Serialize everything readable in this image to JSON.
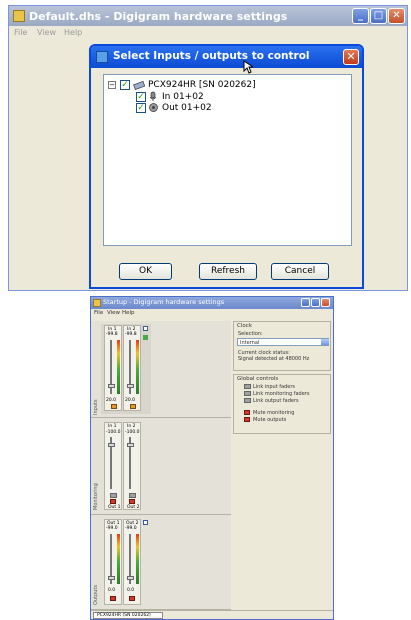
{
  "top_window": {
    "title": "Default.dhs - Digigram hardware settings",
    "menu": [
      "File",
      "View",
      "Help"
    ],
    "buttons": {
      "minimize": "_",
      "maximize": "□",
      "close": "✕"
    }
  },
  "dialog": {
    "title": "Select Inputs / outputs to control",
    "tree": {
      "root": "PCX924HR [SN 020262]",
      "children": [
        "In 01+02",
        "Out 01+02"
      ]
    },
    "buttons": {
      "ok": "OK",
      "refresh": "Refresh",
      "cancel": "Cancel"
    },
    "close_glyph": "✕",
    "expander_glyph": "−",
    "check_glyph": "✓"
  },
  "bottom_window": {
    "title": "Startup - Digigram hardware settings",
    "menu": [
      "File",
      "View",
      "Help"
    ],
    "sections": {
      "inputs": {
        "label": "Inputs",
        "strips": [
          {
            "name": "In 1",
            "gain": "-99.8",
            "value": "20.0"
          },
          {
            "name": "In 2",
            "gain": "-99.8",
            "value": "20.0"
          }
        ]
      },
      "monitoring": {
        "label": "Monitoring",
        "strips": [
          {
            "name": "In 1",
            "value": "-100.0",
            "bottom": "Out 1"
          },
          {
            "name": "In 2",
            "value": "-100.0",
            "bottom": "Out 2"
          }
        ]
      },
      "outputs": {
        "label": "Outputs",
        "strips": [
          {
            "name": "Out 1",
            "value": "-99.0",
            "level": "0.0"
          },
          {
            "name": "Out 2",
            "value": "-99.0",
            "level": "0.0"
          }
        ]
      }
    },
    "clock": {
      "title": "Clock",
      "selection_label": "Selection:",
      "selection_value": "Internal",
      "status_label": "Current clock status:",
      "status_value": "Signal detected at 48000 Hz"
    },
    "global_controls": {
      "title": "Global controls",
      "links": [
        "Link input faders",
        "Link monitoring faders",
        "Link output faders"
      ],
      "mutes": [
        "Mute monitoring",
        "Mute outputs"
      ]
    },
    "status_tab": "PCX924HR (SN 020262)"
  }
}
